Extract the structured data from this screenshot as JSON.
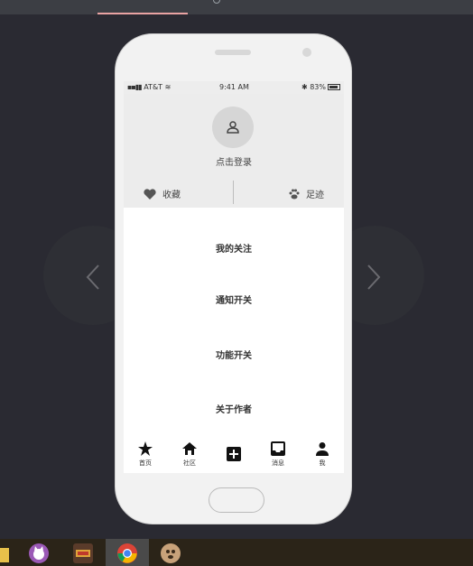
{
  "status_bar": {
    "carrier": "AT&T",
    "time": "9:41 AM",
    "battery": "83%"
  },
  "profile": {
    "login_text": "点击登录",
    "favorites_label": "收藏",
    "footprints_label": "足迹"
  },
  "menu": {
    "items": [
      "我的关注",
      "通知开关",
      "功能开关",
      "关于作者"
    ]
  },
  "tabbar": {
    "tabs": [
      "首页",
      "社区",
      "",
      "消息",
      "我"
    ]
  },
  "taskbar": {
    "icons": [
      "folder-icon",
      "cat-app-icon",
      "game-app-icon",
      "chrome-icon",
      "dog-avatar-icon"
    ]
  }
}
